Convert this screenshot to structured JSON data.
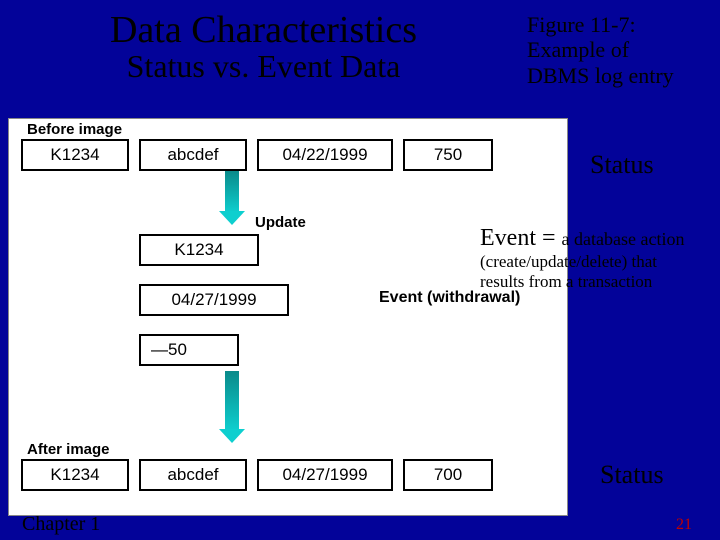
{
  "header": {
    "title_main": "Data Characteristics",
    "title_sub": "Status vs. Event Data",
    "fig_l1": "Figure 11-7:",
    "fig_l2": "Example of",
    "fig_l3": "DBMS log entry"
  },
  "diagram": {
    "before_label": "Before image",
    "before_row": {
      "c1": "K1234",
      "c2": "abcdef",
      "c3": "04/22/1999",
      "c4": "750"
    },
    "update_label": "Update",
    "update_rows": {
      "r1": "K1234",
      "r2": "04/27/1999",
      "r3": "—50"
    },
    "event_label": "Event (withdrawal)",
    "after_label": "After image",
    "after_row": {
      "c1": "K1234",
      "c2": "abcdef",
      "c3": "04/27/1999",
      "c4": "700"
    }
  },
  "annotations": {
    "status1": "Status",
    "status2": "Status",
    "event_prefix": "Event = ",
    "event_small": "a database action",
    "event_rest1": "(create/update/delete) that",
    "event_rest2": "results from a transaction"
  },
  "footer": {
    "chapter": "Chapter 1",
    "page": "21"
  }
}
